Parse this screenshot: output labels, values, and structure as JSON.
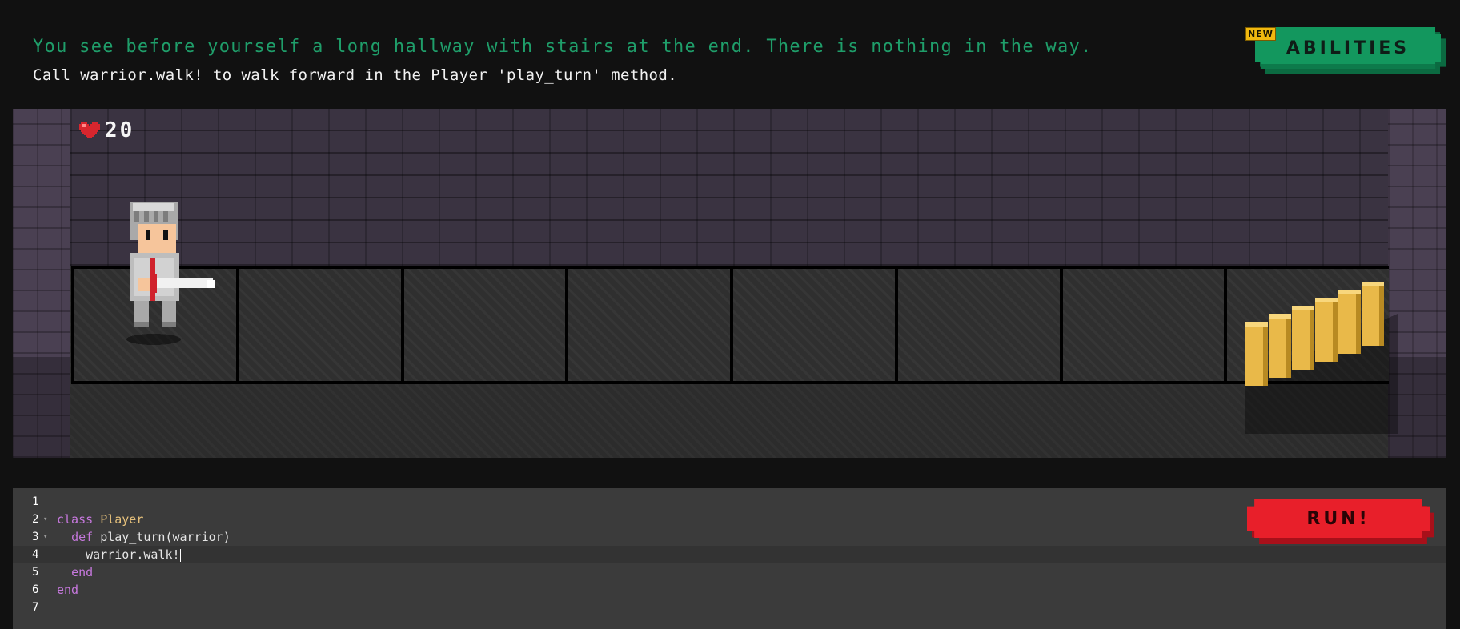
{
  "header": {
    "description": "You see before yourself a long hallway with stairs at the end. There is nothing in the way.",
    "tip": "Call warrior.walk! to walk forward in the Player 'play_turn' method.",
    "abilities_label": "ABILITIES",
    "new_badge": "NEW"
  },
  "game": {
    "health": "20",
    "tile_count": 8,
    "colors": {
      "heart": "#d8262e",
      "floor": "#2f2f2f",
      "wall": "#3a3341",
      "stairs": "#e9b949"
    }
  },
  "editor": {
    "line_numbers": [
      "1",
      "2",
      "3",
      "4",
      "5",
      "6",
      "7"
    ],
    "lines": [
      [],
      [
        {
          "t": "class ",
          "c": "kw"
        },
        {
          "t": "Player",
          "c": "cls"
        }
      ],
      [
        {
          "t": "  "
        },
        {
          "t": "def ",
          "c": "kw"
        },
        {
          "t": "play_turn(warrior)"
        }
      ],
      [
        {
          "t": "    warrior.walk!"
        }
      ],
      [
        {
          "t": "  "
        },
        {
          "t": "end",
          "c": "kw"
        }
      ],
      [
        {
          "t": "end",
          "c": "kw"
        }
      ],
      []
    ],
    "active_line": 4,
    "fold_lines": [
      2,
      3
    ],
    "run_label": "RUN!"
  }
}
